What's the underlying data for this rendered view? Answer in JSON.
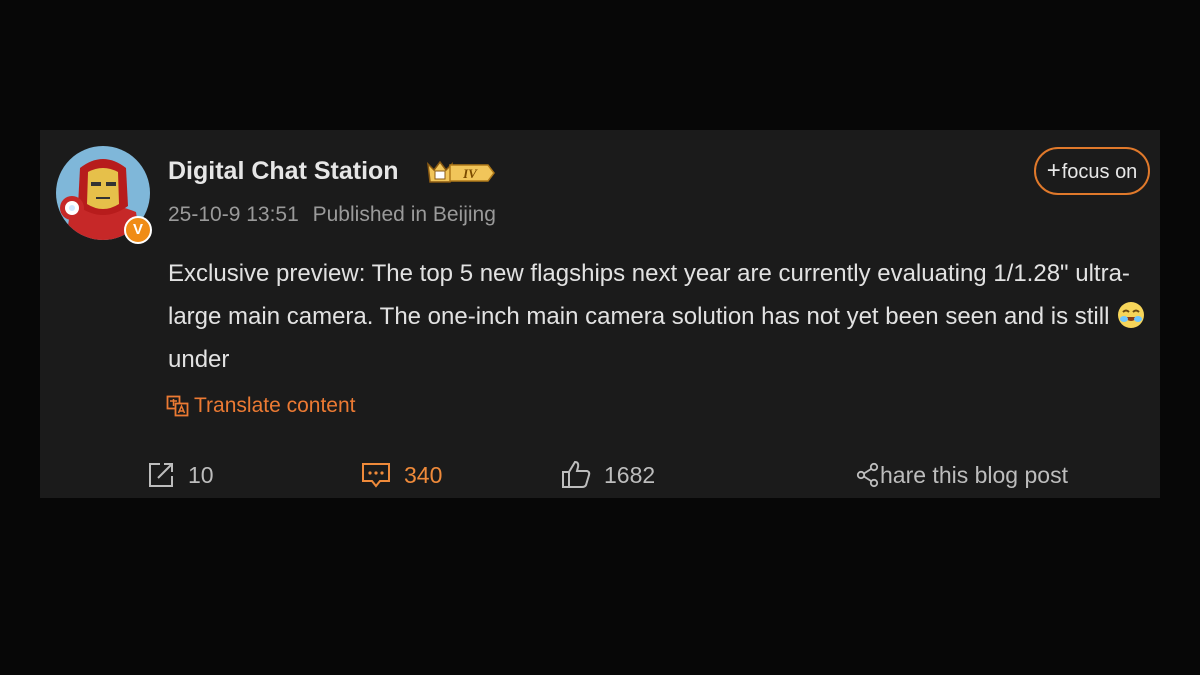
{
  "post": {
    "author": {
      "name": "Digital Chat Station",
      "level_badge": "IV",
      "verified_badge": "V",
      "avatar_icon": "iron-man-avatar"
    },
    "timestamp": "25-10-9 13:51",
    "location": "Published in Beijing",
    "follow_button": {
      "label": "focus on",
      "plus": "+"
    },
    "text_part1": "Exclusive preview: The top 5 new flagships next year are currently evaluating 1/1.28\" ultra-large main camera.  The one-inch main camera solution has not yet been seen and is still ",
    "emoji": "laughing-emoji",
    "text_part2": "under",
    "translate_label": "Translate content"
  },
  "actions": {
    "repost": {
      "icon": "repost-icon",
      "count": "10"
    },
    "comment": {
      "icon": "comment-icon",
      "count": "340"
    },
    "like": {
      "icon": "thumbs-up-icon",
      "count": "1682"
    },
    "share": {
      "icon": "share-icon",
      "label": "hare this blog post"
    }
  },
  "colors": {
    "background": "#070707",
    "card": "#1b1b1b",
    "accent": "#ec7a33",
    "text": "#e2e2e2",
    "muted": "#9a9a9a"
  }
}
